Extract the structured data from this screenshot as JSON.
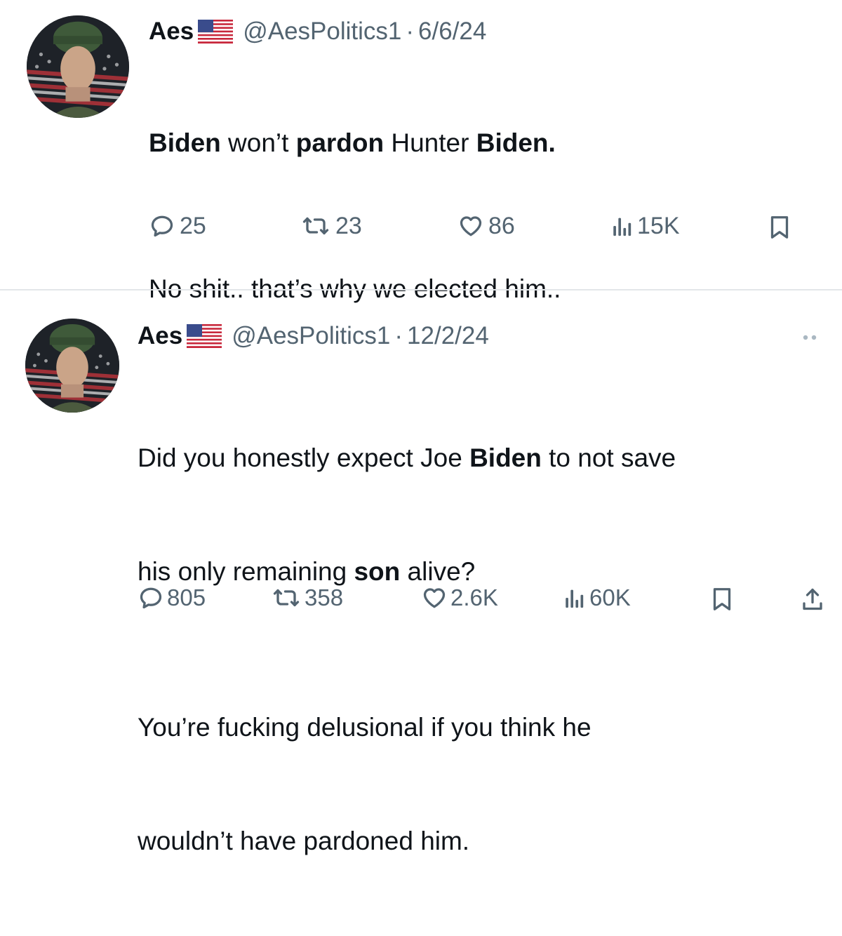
{
  "tweets": [
    {
      "author_name": "Aes",
      "author_handle": "@AesPolitics1",
      "separator": "·",
      "date": "6/6/24",
      "line1_a": "Biden",
      "line1_b": " won’t ",
      "line1_c": "pardon",
      "line1_d": " Hunter ",
      "line1_e": "Biden.",
      "paragraph2": "No shit.. that’s why we elected him..",
      "replies": "25",
      "reposts": "23",
      "likes": "86",
      "views": "15K"
    },
    {
      "author_name": "Aes",
      "author_handle": "@AesPolitics1",
      "separator": "·",
      "date": "12/2/24",
      "line1_a": "Did you honestly expect Joe ",
      "line1_b": "Biden",
      "line1_c": " to not save",
      "line2_a": "his only remaining ",
      "line2_b": "son",
      "line2_c": " alive?",
      "line3": "You’re fucking delusional if you think he",
      "line4": "wouldn’t have pardoned him.",
      "replies": "805",
      "reposts": "358",
      "likes": "2.6K",
      "views": "60K"
    }
  ],
  "colors": {
    "text": "#0f1419",
    "secondary": "#536471",
    "divider": "#e3e6e9"
  },
  "icons": {
    "reply": "reply-icon",
    "repost": "repost-icon",
    "like": "like-icon",
    "views": "views-icon",
    "bookmark": "bookmark-icon",
    "share": "share-icon",
    "more": "more-icon",
    "flag": "us-flag-icon"
  }
}
